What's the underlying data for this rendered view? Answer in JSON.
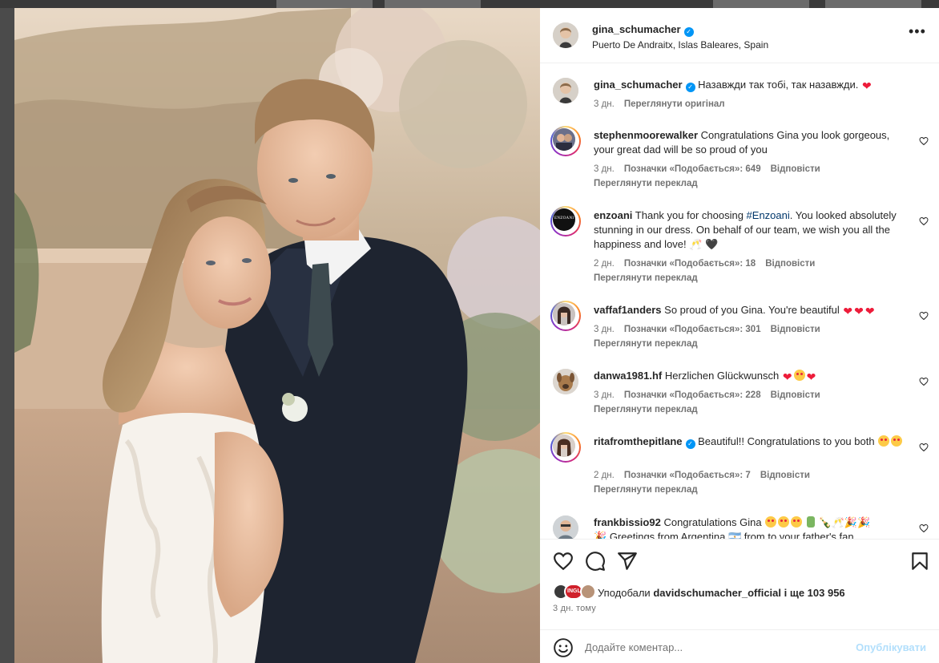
{
  "post": {
    "username": "gina_schumacher",
    "location": "Puerto De Andraitx, Islas Baleares, Spain"
  },
  "caption": {
    "username": "gina_schumacher",
    "text": "Назавжди так тобі, так назавжди.",
    "time": "3 дн.",
    "see_original": "Переглянути оригінал"
  },
  "comments": [
    {
      "username": "stephenmoorewalker",
      "text": "Congratulations Gina you look gorgeous, your great dad will be so proud of you",
      "time": "3 дн.",
      "likes": "Позначки «Подобається»: 649",
      "reply": "Відповісти",
      "translate": "Переглянути переклад"
    },
    {
      "username": "enzoani",
      "text_before": "Thank you for choosing ",
      "hashtag": "#Enzoani",
      "text_after": ". You looked absolutely stunning in our dress. On behalf of our team, we wish you all the happiness and love!",
      "time": "2 дн.",
      "likes": "Позначки «Подобається»: 18",
      "reply": "Відповісти",
      "translate": "Переглянути переклад",
      "avatar_text": "ENZOANI"
    },
    {
      "username": "vaffaf1anders",
      "text": "So proud of you Gina. You're beautiful",
      "time": "3 дн.",
      "likes": "Позначки «Подобається»: 301",
      "reply": "Відповісти",
      "translate": "Переглянути переклад"
    },
    {
      "username": "danwa1981.hf",
      "text": "Herzlichen Glückwunsch",
      "time": "3 дн.",
      "likes": "Позначки «Подобається»: 228",
      "reply": "Відповісти",
      "translate": "Переглянути переклад"
    },
    {
      "username": "ritafromthepitlane",
      "text": "Beautiful!! Congratulations to you both",
      "time": "2 дн.",
      "likes": "Позначки «Подобається»: 7",
      "reply": "Відповісти",
      "translate": "Переглянути переклад"
    },
    {
      "username": "frankbissio92",
      "text": "Congratulations Gina",
      "text_line2": "Greetings from Argentina 🇦🇷 from to your father's fan"
    }
  ],
  "likes": {
    "prefix": "Уподобали",
    "user": "davidschumacher_official",
    "suffix": "і ще 103 956",
    "liker_badge": "INGLI"
  },
  "posted_ago": "3 дн. тому",
  "add_comment": {
    "placeholder": "Додайте коментар...",
    "publish": "Опублікувати"
  },
  "icons": {
    "more": "more-options-icon",
    "like": "heart-icon",
    "comment": "comment-icon",
    "share": "send-icon",
    "save": "bookmark-icon",
    "emoji": "emoji-icon"
  },
  "colors": {
    "verified": "#0095f6",
    "hashtag": "#00376b",
    "publish_disabled": "#b2dffc",
    "heart_emoji": "#ed1c3a"
  }
}
